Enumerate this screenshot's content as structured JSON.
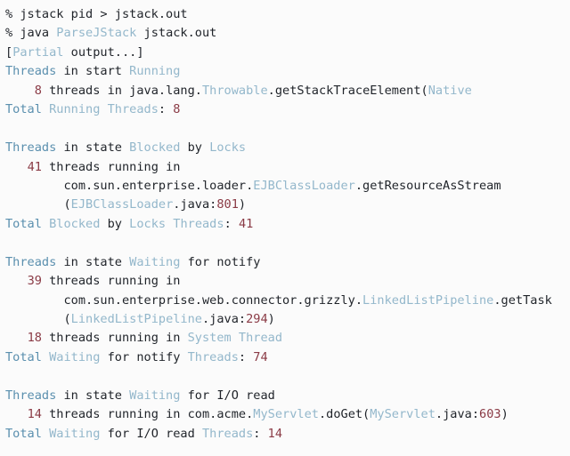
{
  "terminal": {
    "background_color": "#fbfbfb",
    "foreground_color": "#1f2329",
    "accent_key_color": "#5a8fae",
    "accent_ident_color": "#93b7cb",
    "number_color": "#8a3a45",
    "font_size_px": 13.6,
    "line_height_px": 21.45
  },
  "lines": [
    {
      "id": "cmd-jstack",
      "tokens": [
        {
          "t": "% jstack pid > jstack.out",
          "c": "plain"
        }
      ]
    },
    {
      "id": "cmd-parsejstack",
      "tokens": [
        {
          "t": "% java ",
          "c": "plain"
        },
        {
          "t": "ParseJStack",
          "c": "ident"
        },
        {
          "t": " jstack.out",
          "c": "plain"
        }
      ]
    },
    {
      "id": "partial-output-note",
      "tokens": [
        {
          "t": "[",
          "c": "plain"
        },
        {
          "t": "Partial",
          "c": "ident"
        },
        {
          "t": " output...]",
          "c": "plain"
        }
      ]
    },
    {
      "id": "threads-in-start-running",
      "tokens": [
        {
          "t": "Threads",
          "c": "key"
        },
        {
          "t": " in start ",
          "c": "plain"
        },
        {
          "t": "Running",
          "c": "ident"
        }
      ]
    },
    {
      "id": "running-stack-frame",
      "tokens": [
        {
          "t": "    ",
          "c": "plain"
        },
        {
          "t": "8",
          "c": "num"
        },
        {
          "t": " threads in java.lang.",
          "c": "plain"
        },
        {
          "t": "Throwable",
          "c": "ident"
        },
        {
          "t": ".getStackTraceElement(",
          "c": "plain"
        },
        {
          "t": "Native",
          "c": "ident"
        }
      ]
    },
    {
      "id": "total-running-threads",
      "tokens": [
        {
          "t": "Total",
          "c": "key"
        },
        {
          "t": " ",
          "c": "plain"
        },
        {
          "t": "Running",
          "c": "ident"
        },
        {
          "t": " ",
          "c": "plain"
        },
        {
          "t": "Threads",
          "c": "ident"
        },
        {
          "t": ": ",
          "c": "plain"
        },
        {
          "t": "8",
          "c": "num"
        }
      ]
    },
    {
      "id": "blank-1",
      "tokens": [
        {
          "t": " ",
          "c": "plain"
        }
      ]
    },
    {
      "id": "threads-blocked-by-locks-header",
      "tokens": [
        {
          "t": "Threads",
          "c": "key"
        },
        {
          "t": " in state ",
          "c": "plain"
        },
        {
          "t": "Blocked",
          "c": "ident"
        },
        {
          "t": " by ",
          "c": "plain"
        },
        {
          "t": "Locks",
          "c": "ident"
        }
      ]
    },
    {
      "id": "blocked-count",
      "tokens": [
        {
          "t": "   ",
          "c": "plain"
        },
        {
          "t": "41",
          "c": "num"
        },
        {
          "t": " threads running in",
          "c": "plain"
        }
      ]
    },
    {
      "id": "blocked-frame-class",
      "tokens": [
        {
          "t": "        com.sun.enterprise.loader.",
          "c": "plain"
        },
        {
          "t": "EJBClassLoader",
          "c": "ident"
        },
        {
          "t": ".getResourceAsStream",
          "c": "plain"
        }
      ]
    },
    {
      "id": "blocked-frame-source",
      "tokens": [
        {
          "t": "        (",
          "c": "plain"
        },
        {
          "t": "EJBClassLoader",
          "c": "ident"
        },
        {
          "t": ".java:",
          "c": "plain"
        },
        {
          "t": "801",
          "c": "num"
        },
        {
          "t": ")",
          "c": "plain"
        }
      ]
    },
    {
      "id": "total-blocked-threads",
      "tokens": [
        {
          "t": "Total",
          "c": "key"
        },
        {
          "t": " ",
          "c": "plain"
        },
        {
          "t": "Blocked",
          "c": "ident"
        },
        {
          "t": " by ",
          "c": "plain"
        },
        {
          "t": "Locks",
          "c": "ident"
        },
        {
          "t": " ",
          "c": "plain"
        },
        {
          "t": "Threads",
          "c": "ident"
        },
        {
          "t": ": ",
          "c": "plain"
        },
        {
          "t": "41",
          "c": "num"
        }
      ]
    },
    {
      "id": "blank-2",
      "tokens": [
        {
          "t": " ",
          "c": "plain"
        }
      ]
    },
    {
      "id": "threads-waiting-notify-header",
      "tokens": [
        {
          "t": "Threads",
          "c": "key"
        },
        {
          "t": " in state ",
          "c": "plain"
        },
        {
          "t": "Waiting",
          "c": "ident"
        },
        {
          "t": " for notify",
          "c": "plain"
        }
      ]
    },
    {
      "id": "waiting-notify-count",
      "tokens": [
        {
          "t": "   ",
          "c": "plain"
        },
        {
          "t": "39",
          "c": "num"
        },
        {
          "t": " threads running in",
          "c": "plain"
        }
      ]
    },
    {
      "id": "waiting-notify-frame-class",
      "tokens": [
        {
          "t": "        com.sun.enterprise.web.connector.grizzly.",
          "c": "plain"
        },
        {
          "t": "LinkedListPipeline",
          "c": "ident"
        },
        {
          "t": ".getTask",
          "c": "plain"
        }
      ]
    },
    {
      "id": "waiting-notify-frame-source",
      "tokens": [
        {
          "t": "        (",
          "c": "plain"
        },
        {
          "t": "LinkedListPipeline",
          "c": "ident"
        },
        {
          "t": ".java:",
          "c": "plain"
        },
        {
          "t": "294",
          "c": "num"
        },
        {
          "t": ")",
          "c": "plain"
        }
      ]
    },
    {
      "id": "system-thread-count",
      "tokens": [
        {
          "t": "   ",
          "c": "plain"
        },
        {
          "t": "18",
          "c": "num"
        },
        {
          "t": " threads running in ",
          "c": "plain"
        },
        {
          "t": "System",
          "c": "ident"
        },
        {
          "t": " ",
          "c": "plain"
        },
        {
          "t": "Thread",
          "c": "ident"
        }
      ]
    },
    {
      "id": "total-waiting-notify-threads",
      "tokens": [
        {
          "t": "Total",
          "c": "key"
        },
        {
          "t": " ",
          "c": "plain"
        },
        {
          "t": "Waiting",
          "c": "ident"
        },
        {
          "t": " for notify ",
          "c": "plain"
        },
        {
          "t": "Threads",
          "c": "ident"
        },
        {
          "t": ": ",
          "c": "plain"
        },
        {
          "t": "74",
          "c": "num"
        }
      ]
    },
    {
      "id": "blank-3",
      "tokens": [
        {
          "t": " ",
          "c": "plain"
        }
      ]
    },
    {
      "id": "threads-waiting-io-header",
      "tokens": [
        {
          "t": "Threads",
          "c": "key"
        },
        {
          "t": " in state ",
          "c": "plain"
        },
        {
          "t": "Waiting",
          "c": "ident"
        },
        {
          "t": " for I/O read",
          "c": "plain"
        }
      ]
    },
    {
      "id": "waiting-io-frame",
      "tokens": [
        {
          "t": "   ",
          "c": "plain"
        },
        {
          "t": "14",
          "c": "num"
        },
        {
          "t": " threads running in com.acme.",
          "c": "plain"
        },
        {
          "t": "MyServlet",
          "c": "ident"
        },
        {
          "t": ".doGet(",
          "c": "plain"
        },
        {
          "t": "MyServlet",
          "c": "ident"
        },
        {
          "t": ".java:",
          "c": "plain"
        },
        {
          "t": "603",
          "c": "num"
        },
        {
          "t": ")",
          "c": "plain"
        }
      ]
    },
    {
      "id": "total-waiting-io-threads",
      "tokens": [
        {
          "t": "Total",
          "c": "key"
        },
        {
          "t": " ",
          "c": "plain"
        },
        {
          "t": "Waiting",
          "c": "ident"
        },
        {
          "t": " for I/O read ",
          "c": "plain"
        },
        {
          "t": "Threads",
          "c": "ident"
        },
        {
          "t": ": ",
          "c": "plain"
        },
        {
          "t": "14",
          "c": "num"
        }
      ]
    }
  ]
}
